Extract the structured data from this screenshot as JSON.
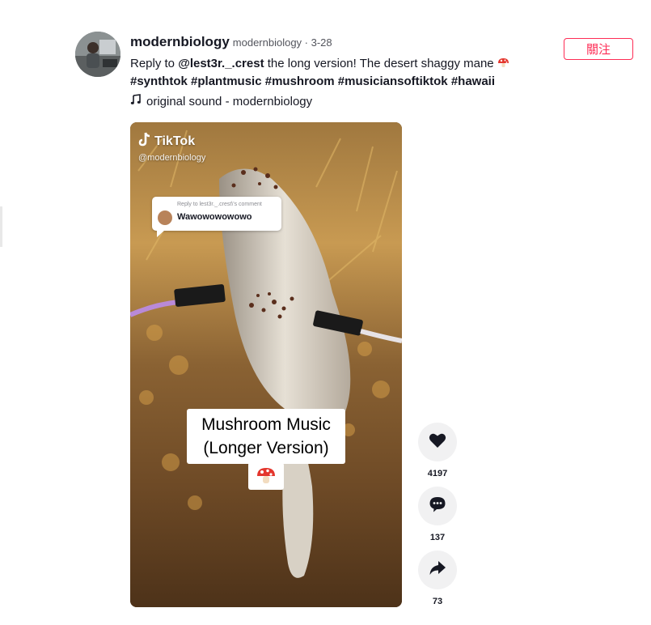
{
  "post": {
    "author_name": "modernbiology",
    "author_meta": "modernbiology · 3-28",
    "caption": {
      "prefix": "Reply to ",
      "mention": "@lest3r._.crest",
      "text": " the long version! The desert shaggy mane",
      "hashtags": [
        "#synthtok",
        "#plantmusic",
        "#mushroom",
        "#musiciansoftiktok",
        "#hawaii"
      ]
    },
    "music": "original sound - modernbiology",
    "follow_label": "關注"
  },
  "video": {
    "watermark_brand": "TikTok",
    "watermark_handle": "@modernbiology",
    "reply_header": "Reply to lest3r._.crest\\'s comment",
    "reply_text": "Wawowowowowo",
    "overlay_line1": "Mushroom Music",
    "overlay_line2": "(Longer Version)"
  },
  "actions": {
    "likes": "4197",
    "comments": "137",
    "shares": "73"
  },
  "icons": {
    "like": "heart-icon",
    "comment": "comment-icon",
    "share": "share-icon",
    "music": "music-note-icon",
    "mushroom": "mushroom-emoji-icon"
  },
  "colors": {
    "accent": "#fe2c55",
    "text": "#161823",
    "action_bg": "#f1f1f2"
  }
}
